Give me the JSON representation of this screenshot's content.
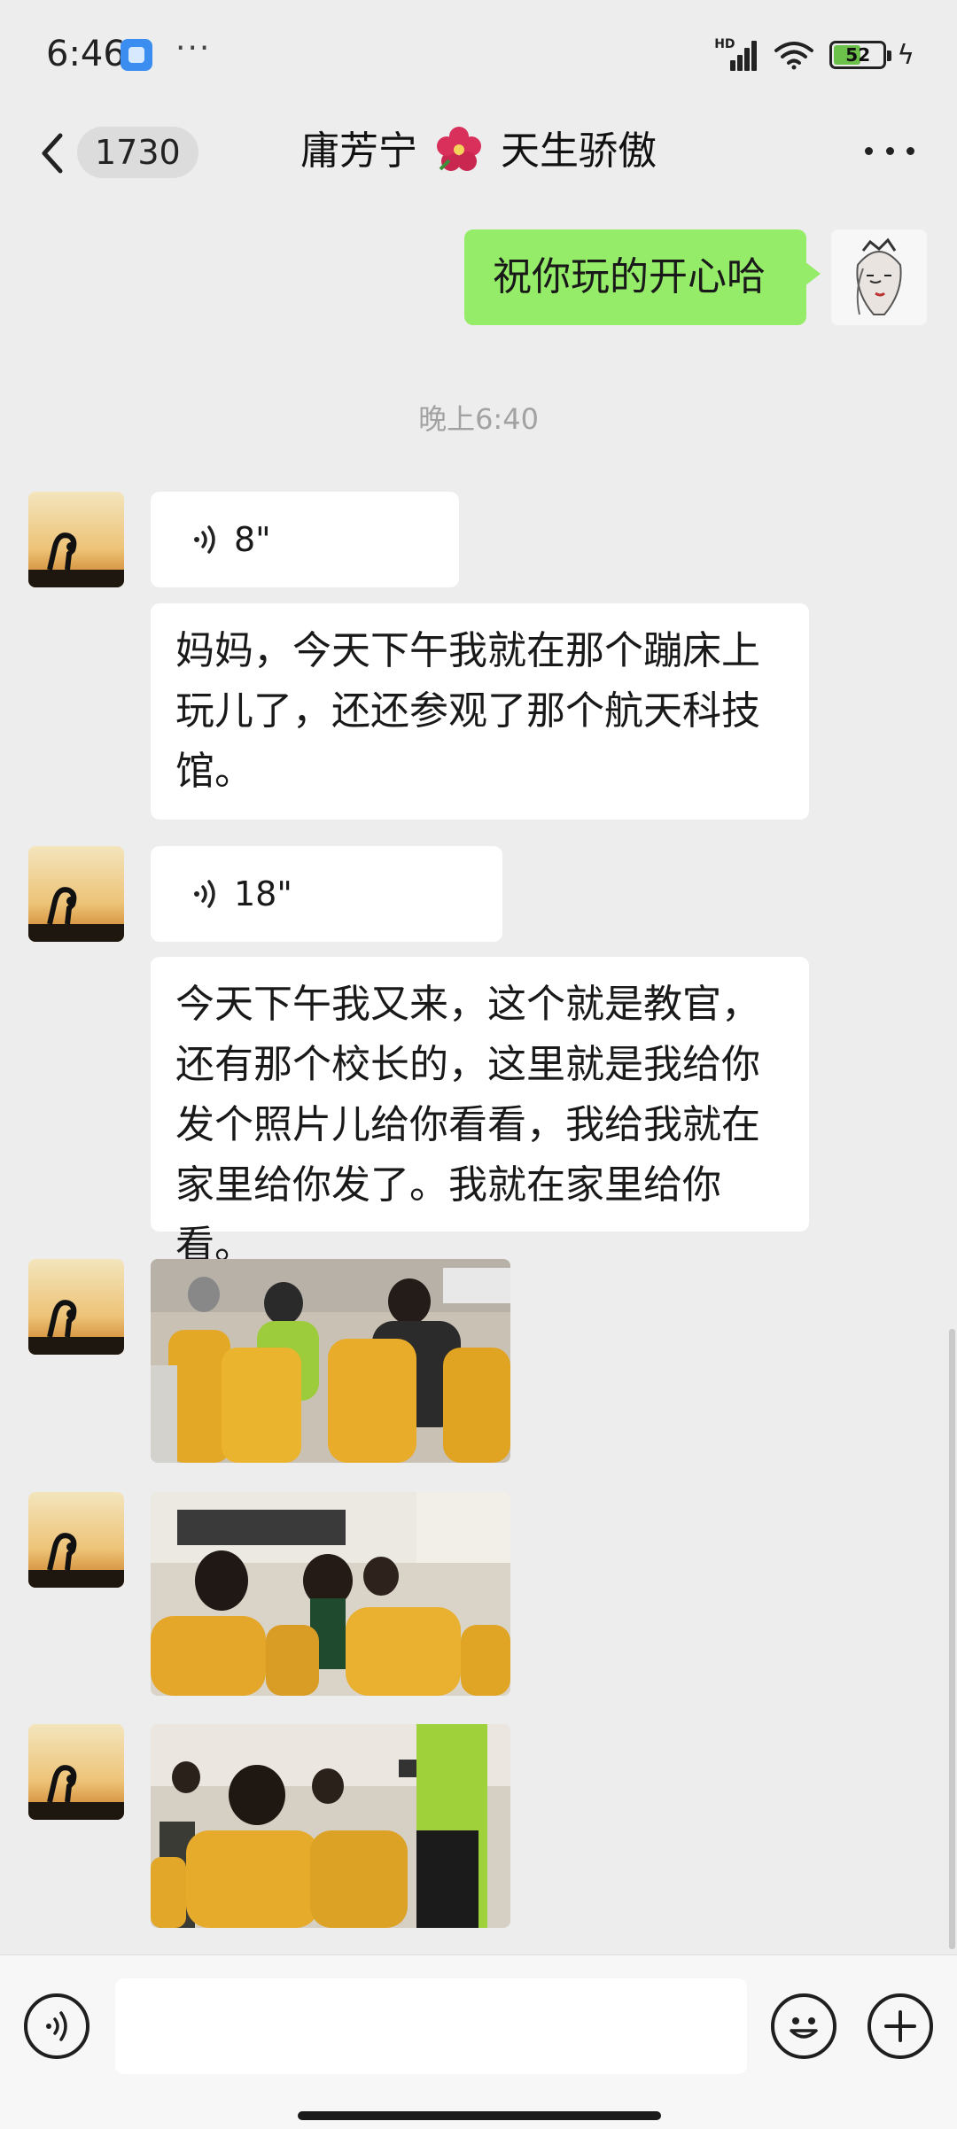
{
  "status_bar": {
    "time": "6:46",
    "more": "···",
    "network_label": "HD",
    "battery": "52"
  },
  "header": {
    "unread_count": "1730",
    "title_name": "庸芳宁",
    "title_suffix": "天生骄傲"
  },
  "messages": {
    "outgoing_text": "祝你玩的开心哈",
    "timestamp": "晚上6:40",
    "voice_1_duration": "8\"",
    "text_1": "妈妈，今天下午我就在那个蹦床上玩儿了，还还参观了那个航天科技馆。",
    "voice_2_duration": "18\"",
    "text_2": "今天下午我又来，这个就是教官，还有那个校长的，这里就是我给你发个照片儿给你看看，我给我就在家里给你发了。我就在家里给你看。"
  },
  "icons": {
    "back": "chevron-left-icon",
    "more": "more-horizontal-icon",
    "voice_toggle": "voice-icon",
    "emoji": "emoji-icon",
    "plus": "plus-icon"
  },
  "colors": {
    "background": "#ededed",
    "outgoing_bubble": "#95ec69",
    "incoming_bubble": "#ffffff",
    "timestamp": "#a2a2a2"
  }
}
